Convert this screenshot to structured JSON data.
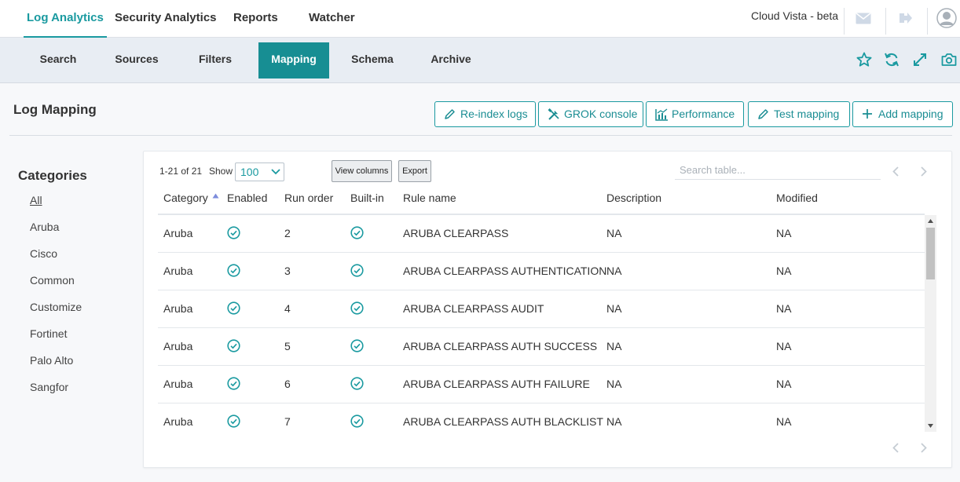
{
  "topnav": {
    "tabs": [
      {
        "label": "Log Analytics",
        "active": true
      },
      {
        "label": "Security Analytics",
        "active": false
      },
      {
        "label": "Reports",
        "active": false
      },
      {
        "label": "Watcher",
        "active": false
      }
    ],
    "brand": "Cloud Vista - beta",
    "icons": [
      "mail-icon",
      "logout-icon",
      "user-avatar-icon"
    ]
  },
  "subnav": {
    "tabs": [
      {
        "label": "Search",
        "active": false
      },
      {
        "label": "Sources",
        "active": false
      },
      {
        "label": "Filters",
        "active": false
      },
      {
        "label": "Mapping",
        "active": true
      },
      {
        "label": "Schema",
        "active": false
      },
      {
        "label": "Archive",
        "active": false
      }
    ],
    "icons": [
      "star-icon",
      "refresh-icon",
      "expand-icon",
      "camera-icon"
    ]
  },
  "page": {
    "title": "Log Mapping",
    "actions": [
      {
        "label": "Re-index logs",
        "icon": "pencil-icon"
      },
      {
        "label": "GROK console",
        "icon": "tools-icon"
      },
      {
        "label": "Performance",
        "icon": "chart-icon"
      },
      {
        "label": "Test mapping",
        "icon": "pencil-alt-icon"
      },
      {
        "label": "Add mapping",
        "icon": "plus-icon"
      }
    ]
  },
  "categories": {
    "title": "Categories",
    "items": [
      "All",
      "Aruba",
      "Cisco",
      "Common",
      "Customize",
      "Fortinet",
      "Palo Alto",
      "Sangfor"
    ],
    "selected": "All"
  },
  "table": {
    "count": "1-21 of 21",
    "show_label": "Show",
    "page_size": "100",
    "view_columns": "View columns",
    "export": "Export",
    "search_placeholder": "Search table...",
    "sort_column": "Category",
    "sort_dir": "asc",
    "columns": [
      "Category",
      "Enabled",
      "Run order",
      "Built-in",
      "Rule name",
      "Description",
      "Modified"
    ],
    "rows": [
      {
        "category": "Aruba",
        "enabled": true,
        "run_order": "2",
        "builtin": true,
        "rule": "ARUBA CLEARPASS",
        "description": "NA",
        "modified": "NA"
      },
      {
        "category": "Aruba",
        "enabled": true,
        "run_order": "3",
        "builtin": true,
        "rule": "ARUBA CLEARPASS AUTHENTICATION",
        "description": "NA",
        "modified": "NA"
      },
      {
        "category": "Aruba",
        "enabled": true,
        "run_order": "4",
        "builtin": true,
        "rule": "ARUBA CLEARPASS AUDIT",
        "description": "NA",
        "modified": "NA"
      },
      {
        "category": "Aruba",
        "enabled": true,
        "run_order": "5",
        "builtin": true,
        "rule": "ARUBA CLEARPASS AUTH SUCCESS",
        "description": "NA",
        "modified": "NA"
      },
      {
        "category": "Aruba",
        "enabled": true,
        "run_order": "6",
        "builtin": true,
        "rule": "ARUBA CLEARPASS AUTH FAILURE",
        "description": "NA",
        "modified": "NA"
      },
      {
        "category": "Aruba",
        "enabled": true,
        "run_order": "7",
        "builtin": true,
        "rule": "ARUBA CLEARPASS AUTH BLACKLIST",
        "description": "NA",
        "modified": "NA"
      }
    ]
  },
  "colors": {
    "accent": "#1a9aa0",
    "accent_dark": "#178e93",
    "subnav_bg": "#e8edf3"
  }
}
